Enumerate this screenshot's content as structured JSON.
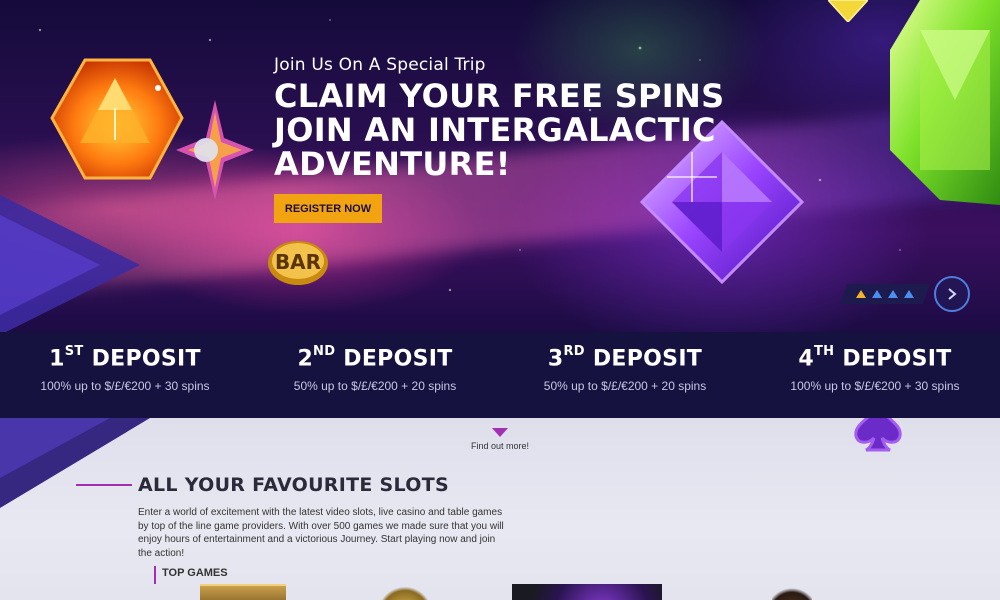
{
  "hero": {
    "subtitle": "Join Us On A Special Trip",
    "headline": [
      "CLAIM YOUR FREE SPINS",
      "JOIN AN INTERGALACTIC",
      "ADVENTURE!"
    ],
    "cta_label": "REGISTER NOW",
    "badge_label": "BAR",
    "slider": {
      "slides": 4,
      "active": 1
    }
  },
  "deposits": [
    {
      "num": "1",
      "suffix": "ST",
      "word": "DEPOSIT",
      "detail": "100% up to $/£/€200 + 30 spins"
    },
    {
      "num": "2",
      "suffix": "ND",
      "word": "DEPOSIT",
      "detail": "50% up to $/£/€200 + 20 spins"
    },
    {
      "num": "3",
      "suffix": "RD",
      "word": "DEPOSIT",
      "detail": "50% up to $/£/€200 + 20 spins"
    },
    {
      "num": "4",
      "suffix": "TH",
      "word": "DEPOSIT",
      "detail": "100% up to $/£/€200 + 30 spins"
    }
  ],
  "find_more": "Find out more!",
  "slots_section": {
    "title": "ALL YOUR FAVOURITE SLOTS",
    "body": "Enter a world of excitement with the latest video slots, live casino and table games by top of the line game providers. With over 500 games we made sure that you will enjoy hours of entertainment and a victorious Journey. Start playing now and join the action!",
    "top_games_label": "TOP GAMES"
  },
  "colors": {
    "accent_orange": "#f2a312",
    "navy": "#15123f",
    "purple_accent": "#a12fb0",
    "slider_blue": "#4b8ff0"
  }
}
